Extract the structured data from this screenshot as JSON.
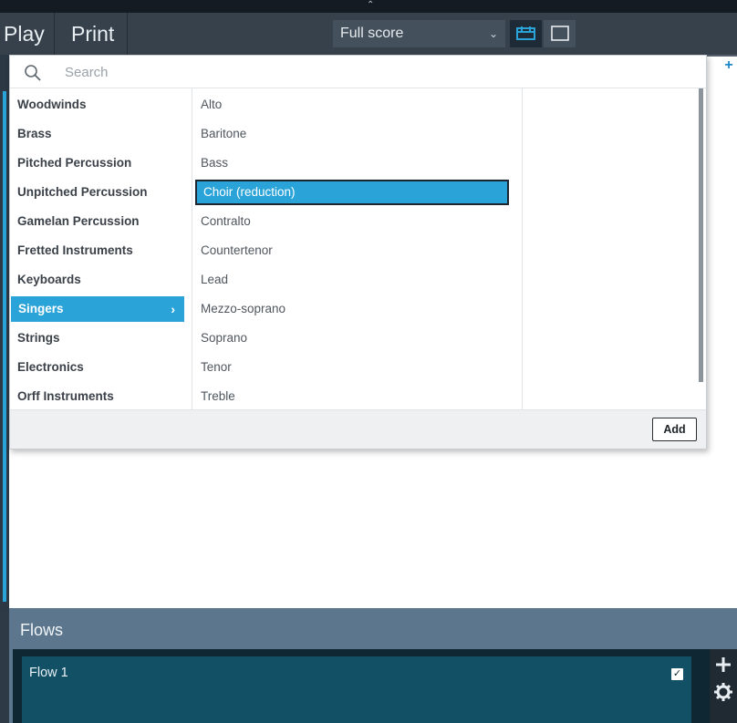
{
  "toolbar": {
    "play_label": "Play",
    "print_label": "Print",
    "layout_value": "Full score"
  },
  "popup": {
    "search": {
      "placeholder": "Search",
      "value": ""
    },
    "families": [
      "Woodwinds",
      "Brass",
      "Pitched Percussion",
      "Unpitched Percussion",
      "Gamelan Percussion",
      "Fretted Instruments",
      "Keyboards",
      "Singers",
      "Strings",
      "Electronics",
      "Orff Instruments"
    ],
    "selected_family_index": 7,
    "instruments": [
      "Alto",
      "Baritone",
      "Bass",
      "Choir (reduction)",
      "Contralto",
      "Countertenor",
      "Lead",
      "Mezzo-soprano",
      "Soprano",
      "Tenor",
      "Treble"
    ],
    "selected_instrument_index": 3,
    "add_label": "Add"
  },
  "flows": {
    "title": "Flows",
    "items": [
      {
        "name": "Flow 1",
        "checked": true
      }
    ]
  },
  "colors": {
    "accent": "#2aa3d8",
    "toolbar_bg": "#36414c",
    "flows_header": "#5b768d",
    "flow_card": "#125066"
  },
  "icons": {
    "search": "magnifier-icon",
    "plus": "plus-icon",
    "settings": "gear-icon"
  }
}
